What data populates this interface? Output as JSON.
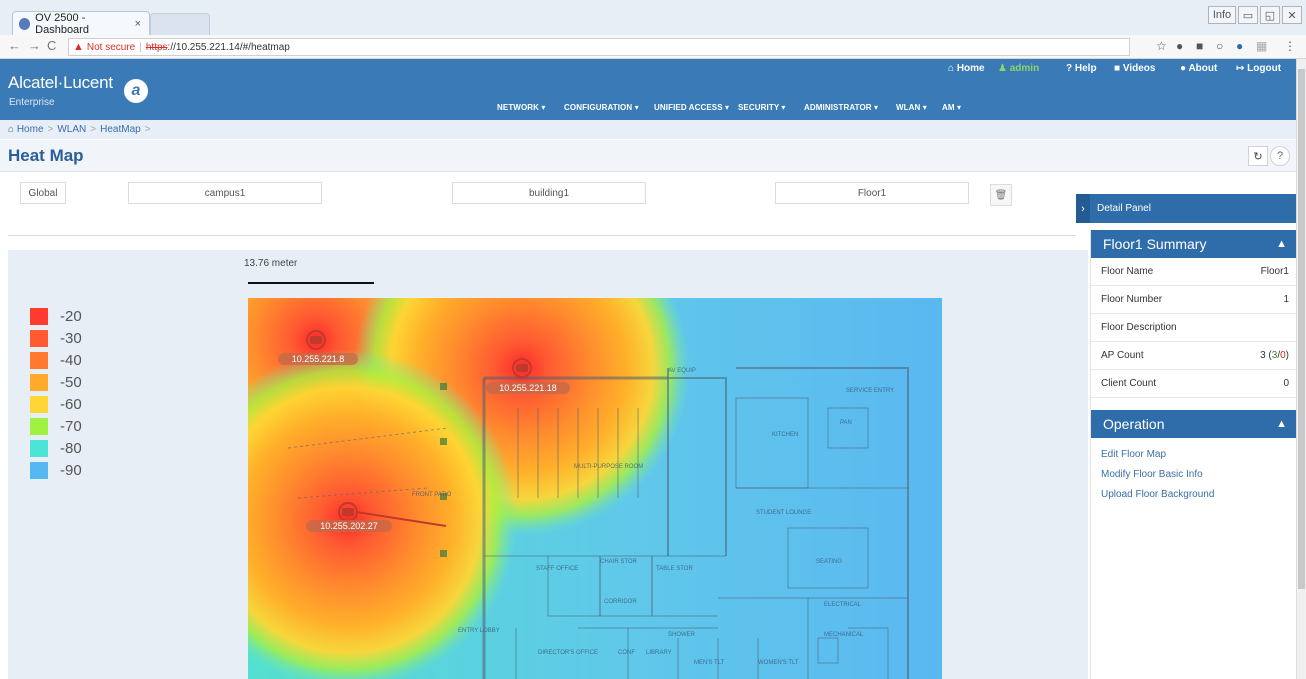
{
  "browser": {
    "tab_title": "OV 2500 - Dashboard",
    "tab_close": "×",
    "not_secure": "Not secure",
    "url_scheme": "https",
    "url_rest": "://10.255.221.14/#/heatmap",
    "window_ctl_user": "Info"
  },
  "header": {
    "brand": "Alcatel·Lucent",
    "brand_sub": "Enterprise",
    "top_links": {
      "home": "Home",
      "user": "admin",
      "help": "Help",
      "videos": "Videos",
      "about": "About",
      "logout": "Logout"
    },
    "main_nav": [
      "NETWORK",
      "CONFIGURATION",
      "UNIFIED ACCESS",
      "SECURITY",
      "ADMINISTRATOR",
      "WLAN",
      "AM"
    ]
  },
  "breadcrumb": [
    "Home",
    "WLAN",
    "HeatMap"
  ],
  "page_title": "Heat Map",
  "selectors": {
    "global": "Global",
    "campus": "campus1",
    "building": "building1",
    "floor": "Floor1"
  },
  "map": {
    "scale_label": "13.76  meter",
    "legend": [
      {
        "label": "-20",
        "color": "#ff3b30"
      },
      {
        "label": "-30",
        "color": "#ff5a32"
      },
      {
        "label": "-40",
        "color": "#ff7a2e"
      },
      {
        "label": "-50",
        "color": "#ffaa2a"
      },
      {
        "label": "-60",
        "color": "#ffd633"
      },
      {
        "label": "-70",
        "color": "#9ff240"
      },
      {
        "label": "-80",
        "color": "#4de4d8"
      },
      {
        "label": "-90",
        "color": "#55b8f0"
      }
    ],
    "ap_labels": [
      "10.255.221.8",
      "10.255.221.18",
      "10.255.202.27"
    ],
    "room_labels": [
      "MULTI-PURPOSE ROOM",
      "KITCHEN",
      "STUDENT LOUNGE",
      "SEATING",
      "STAFF OFFICE",
      "CHAIR STOR",
      "TABLE STOR",
      "CORRIDOR",
      "ELECTRICAL",
      "MECHANICAL",
      "ENTRY LOBBY",
      "DIRECTOR'S OFFICE",
      "CONF",
      "LIBRARY",
      "SHOWER",
      "MEN'S TLT",
      "WOMEN'S TLT",
      "FRONT PATIO",
      "SERVICE ENTRY",
      "AV EQUIP",
      "PAN"
    ]
  },
  "detail_panel": {
    "title": "Detail Panel",
    "summary": {
      "header": "Floor1 Summary",
      "rows": [
        {
          "key": "Floor Name",
          "value": "Floor1"
        },
        {
          "key": "Floor Number",
          "value": "1"
        },
        {
          "key": "Floor Description",
          "value": ""
        },
        {
          "key": "AP Count",
          "value": "3"
        },
        {
          "key": "Client Count",
          "value": "0"
        }
      ],
      "ap_up": "3",
      "ap_down": "0"
    },
    "operation": {
      "header": "Operation",
      "links": [
        "Edit Floor Map",
        "Modify Floor Basic Info",
        "Upload Floor Background"
      ]
    }
  }
}
